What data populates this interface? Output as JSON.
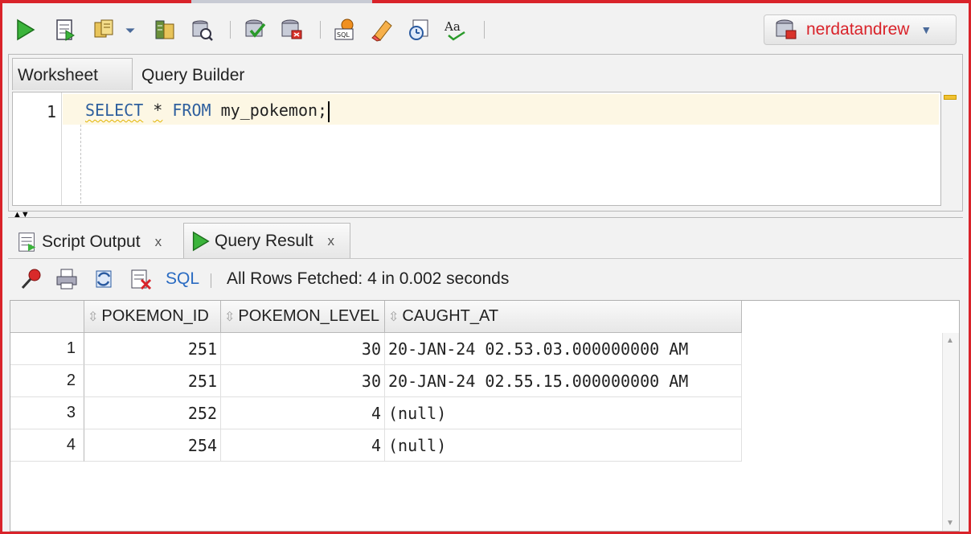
{
  "connection": {
    "name": "nerdatandrew"
  },
  "editor": {
    "tabs": [
      "Worksheet",
      "Query Builder"
    ],
    "line_number": "1",
    "code": {
      "kw1": "SELECT",
      "star": "*",
      "kw2": "FROM",
      "rest": "my_pokemon;"
    }
  },
  "results": {
    "tabs": [
      {
        "label": "Script Output",
        "close": "x"
      },
      {
        "label": "Query Result",
        "close": "x"
      }
    ],
    "toolbar": {
      "sql_label": "SQL",
      "status": "All Rows Fetched: 4 in 0.002 seconds"
    },
    "columns": [
      "POKEMON_ID",
      "POKEMON_LEVEL",
      "CAUGHT_AT"
    ],
    "rows": [
      {
        "n": "1",
        "id": "251",
        "level": "30",
        "caught": "20-JAN-24 02.53.03.000000000 AM"
      },
      {
        "n": "2",
        "id": "251",
        "level": "30",
        "caught": "20-JAN-24 02.55.15.000000000 AM"
      },
      {
        "n": "3",
        "id": "252",
        "level": "4",
        "caught": "(null)"
      },
      {
        "n": "4",
        "id": "254",
        "level": "4",
        "caught": "(null)"
      }
    ]
  },
  "icons": {
    "toolbar": [
      "run-statement-icon",
      "run-script-icon",
      "commit-icon",
      "dropdown-icon",
      "explain-plan-icon",
      "autotrace-icon",
      "commit-db-icon",
      "rollback-icon",
      "sql-tuning-icon",
      "clear-icon",
      "history-icon",
      "format-icon"
    ],
    "results_toolbar": [
      "pin-icon",
      "print-icon",
      "refresh-icon",
      "export-icon"
    ]
  },
  "colors": {
    "frame": "#d9232a",
    "connection_text": "#d9232a",
    "keyword": "#2e5f9e",
    "current_line": "#fdf7e4"
  }
}
